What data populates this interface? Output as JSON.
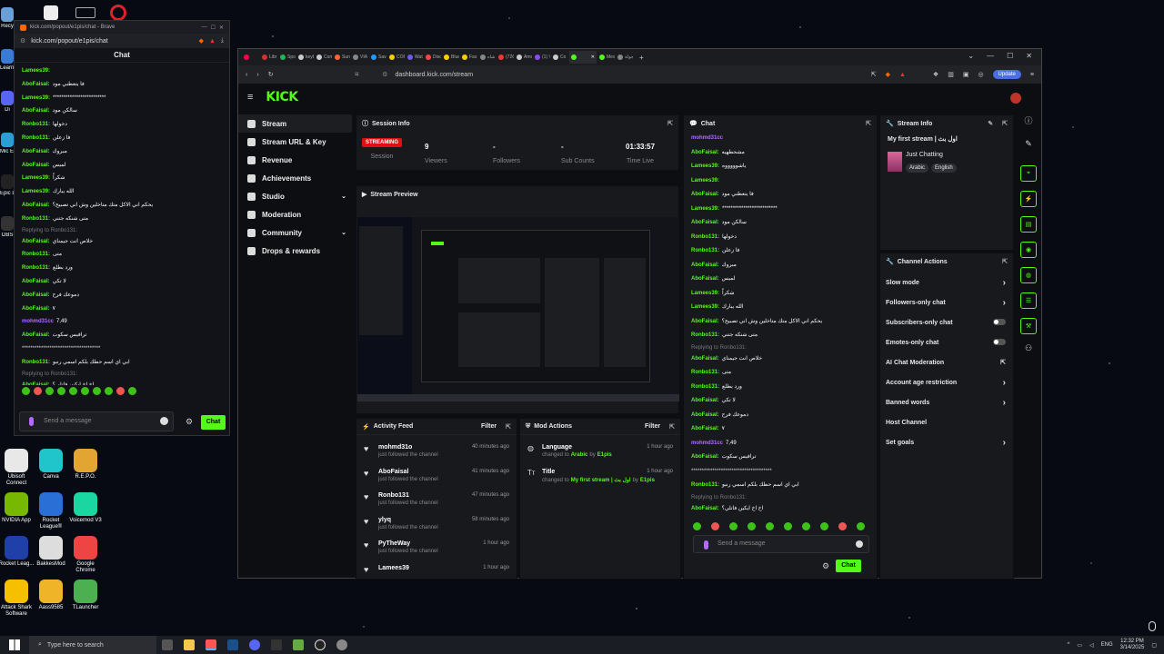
{
  "desktop": {
    "top_icons": [
      "Recy",
      "Learn this",
      "Di",
      "Mic Ed",
      "Epic Lau",
      "OBS"
    ],
    "bottom_icons": [
      {
        "label": "Ubisoft Connect",
        "color": "#e8e8e8"
      },
      {
        "label": "Canva",
        "color": "#20c4cb"
      },
      {
        "label": "R.E.P.O.",
        "color": "#e2a531"
      },
      {
        "label": "NVIDIA App",
        "color": "#76b900"
      },
      {
        "label": "Rocket League®",
        "color": "#2a6fd6"
      },
      {
        "label": "Voicemod V3",
        "color": "#1ad6a0"
      },
      {
        "label": "Rocket Leag...",
        "color": "#1e40a8"
      },
      {
        "label": "BakkesMod",
        "color": "#ddd"
      },
      {
        "label": "Google Chrome",
        "color": "#e44"
      },
      {
        "label": "Attack Shark Software",
        "color": "#f6c000"
      },
      {
        "label": "Aass9585",
        "color": "#f0b429"
      },
      {
        "label": "TLauncher",
        "color": "#4caf50"
      }
    ]
  },
  "popout": {
    "title": "kick.com/popout/e1pis/chat - Brave",
    "url": "kick.com/popout/e1pis/chat",
    "header": "Chat",
    "messages": [
      {
        "user": "Lamees39:",
        "text": "",
        "color": "g"
      },
      {
        "user": "AboFaisal:",
        "text": "فا يتعطني مود",
        "color": "g"
      },
      {
        "user": "Lamees39:",
        "text": "*************************",
        "color": "g"
      },
      {
        "user": "AboFaisal:",
        "text": "سالكن مود",
        "color": "g"
      },
      {
        "user": "Ronbo131:",
        "text": "دخولها",
        "color": "g"
      },
      {
        "user": "Ronbo131:",
        "text": "فا زعلن",
        "color": "g"
      },
      {
        "user": "AboFaisal:",
        "text": "مبروك",
        "color": "g"
      },
      {
        "user": "AboFaisal:",
        "text": "لميس",
        "color": "g"
      },
      {
        "user": "Lamees39:",
        "text": "شكراً",
        "color": "g"
      },
      {
        "user": "Lamees39:",
        "text": "الله يبارك",
        "color": "g"
      },
      {
        "user": "AboFaisal:",
        "text": "يحكم اني الاكل متك متاخلين وش اني تصبيح؟",
        "color": "g"
      },
      {
        "user": "Ronbo131:",
        "text": "متى شنكه جتني",
        "color": "g"
      },
      {
        "user": "AboFaisal:",
        "text": "خلاص انت جيمناي",
        "color": "g",
        "reply": "Replying to Ronbo131:"
      },
      {
        "user": "Ronbo131:",
        "text": "متى",
        "color": "g"
      },
      {
        "user": "Ronbo131:",
        "text": "ورد بطلع",
        "color": "g"
      },
      {
        "user": "AboFaisal:",
        "text": "لا تكي",
        "color": "g"
      },
      {
        "user": "AboFaisal:",
        "text": "دموعك فرح",
        "color": "g"
      },
      {
        "user": "AboFaisal:",
        "text": "٧",
        "color": "g"
      },
      {
        "user": "mohmd31cc",
        "text": "7,49",
        "color": "p"
      },
      {
        "user": "AboFaisal:",
        "text": "ترافيس سكوت",
        "color": "g"
      },
      {
        "user": "",
        "text": "*************************************",
        "color": "w"
      },
      {
        "user": "Ronbo131:",
        "text": "ابي اي اسم حطك بلكم اسمي رنبو",
        "color": "g"
      },
      {
        "user": "AboFaisal:",
        "text": "اخ اخ ايكين فاتلي؟",
        "color": "g",
        "reply": "Replying to Ronbo131:"
      }
    ],
    "input_placeholder": "Send a message",
    "chat_button": "Chat"
  },
  "browser": {
    "tabs": [
      {
        "label": "",
        "color": "#f04"
      },
      {
        "label": "Libr",
        "color": "#c33"
      },
      {
        "label": "Spo",
        "color": "#1db954"
      },
      {
        "label": "keyb",
        "color": "#ccc"
      },
      {
        "label": "Com",
        "color": "#ccc"
      },
      {
        "label": "Sun",
        "color": "#f63"
      },
      {
        "label": "VIA",
        "color": "#888"
      },
      {
        "label": "Save",
        "color": "#29f"
      },
      {
        "label": "COR",
        "color": "#fc0"
      },
      {
        "label": "Wat",
        "color": "#6c5ce7"
      },
      {
        "label": "Disc",
        "color": "#f44"
      },
      {
        "label": "Blue",
        "color": "#fc0"
      },
      {
        "label": "Fas",
        "color": "#fc0"
      },
      {
        "label": "شاه",
        "color": "#888"
      },
      {
        "label": "(726",
        "color": "#f33"
      },
      {
        "label": "Ams",
        "color": "#ccc"
      },
      {
        "label": "(1) V",
        "color": "#9146ff"
      },
      {
        "label": "Co",
        "color": "#ccc"
      },
      {
        "label": "",
        "color": "#53fc18",
        "active": true
      },
      {
        "label": "Mes",
        "color": "#53fc18"
      },
      {
        "label": "جولة",
        "color": "#888"
      }
    ],
    "url": "dashboard.kick.com/stream",
    "update_button": "Update"
  },
  "kick": {
    "logo": "KICK",
    "nav": [
      {
        "label": "Stream",
        "active": true
      },
      {
        "label": "Stream URL & Key"
      },
      {
        "label": "Revenue"
      },
      {
        "label": "Achievements"
      },
      {
        "label": "Studio",
        "chevron": true
      },
      {
        "label": "Moderation"
      },
      {
        "label": "Community",
        "chevron": true
      },
      {
        "label": "Drops & rewards"
      }
    ],
    "session": {
      "title": "Session Info",
      "status": "STREAMING",
      "session_label": "Session",
      "viewers_value": "9",
      "viewers_label": "Viewers",
      "followers_value": "-",
      "followers_label": "Followers",
      "subs_value": "-",
      "subs_label": "Sub Counts",
      "time_value": "01:33:57",
      "time_label": "Time Live"
    },
    "preview_title": "Stream Preview",
    "activity": {
      "title": "Activity Feed",
      "filter": "Filter",
      "items": [
        {
          "name": "mohmd31o",
          "sub": "just followed the channel",
          "time": "40 minutes ago"
        },
        {
          "name": "AboFaisal",
          "sub": "just followed the channel",
          "time": "41 minutes ago"
        },
        {
          "name": "Ronbo131",
          "sub": "just followed the channel",
          "time": "47 minutes ago"
        },
        {
          "name": "ylyq",
          "sub": "just followed the channel",
          "time": "58 minutes ago"
        },
        {
          "name": "PyTheWay",
          "sub": "just followed the channel",
          "time": "1 hour ago"
        },
        {
          "name": "Lamees39",
          "sub": "",
          "time": "1 hour ago"
        }
      ]
    },
    "mod": {
      "title": "Mod Actions",
      "filter": "Filter",
      "items": [
        {
          "name": "Language",
          "sub_prefix": "changed to",
          "sub_value": "Arabic",
          "by": "by",
          "user": "E1pis",
          "time": "1 hour ago"
        },
        {
          "name": "Title",
          "sub_prefix": "changed to",
          "sub_value": "My first stream | اول بث",
          "by": "by",
          "user": "E1pis",
          "time": "1 hour ago"
        }
      ]
    },
    "chat": {
      "title": "Chat",
      "messages": [
        {
          "user": "mohmd31cc",
          "text": "",
          "color": "p"
        },
        {
          "user": "AboFaisal:",
          "text": "مشحطهيه",
          "color": "g"
        },
        {
          "user": "Lamees39:",
          "text": "ياشوووووه",
          "color": "g"
        },
        {
          "user": "Lamees39:",
          "text": "",
          "color": "g"
        },
        {
          "user": "AboFaisal:",
          "text": "فا يتعطني مود",
          "color": "g"
        },
        {
          "user": "Lamees39:",
          "text": "**************************",
          "color": "g"
        },
        {
          "user": "AboFaisal:",
          "text": "سالكن مود",
          "color": "g"
        },
        {
          "user": "Ronbo131:",
          "text": "دخولها",
          "color": "g"
        },
        {
          "user": "Ronbo131:",
          "text": "فا زعلن",
          "color": "g"
        },
        {
          "user": "AboFaisal:",
          "text": "مبروك",
          "color": "g"
        },
        {
          "user": "AboFaisal:",
          "text": "لميس",
          "color": "g"
        },
        {
          "user": "Lamees39:",
          "text": "شكراً",
          "color": "g"
        },
        {
          "user": "Lamees39:",
          "text": "الله يبارك",
          "color": "g"
        },
        {
          "user": "AboFaisal:",
          "text": "يحكم اني الاكل متك متاخلين وش اني تصبيح؟",
          "color": "g"
        },
        {
          "user": "Ronbo131:",
          "text": "متى شنكه جتني",
          "color": "g"
        },
        {
          "user": "AboFaisal:",
          "text": "خلاص انت جيمناي",
          "color": "g",
          "reply": "Replying to Ronbo131:"
        },
        {
          "user": "Ronbo131:",
          "text": "متى",
          "color": "g"
        },
        {
          "user": "Ronbo131:",
          "text": "ورد بطلع",
          "color": "g"
        },
        {
          "user": "AboFaisal:",
          "text": "لا تكي",
          "color": "g"
        },
        {
          "user": "AboFaisal:",
          "text": "دموعك فرح",
          "color": "g"
        },
        {
          "user": "AboFaisal:",
          "text": "٧",
          "color": "g"
        },
        {
          "user": "mohmd31cc",
          "text": "7,49",
          "color": "p"
        },
        {
          "user": "AboFaisal:",
          "text": "ترافيس سكوت",
          "color": "g"
        },
        {
          "user": "",
          "text": "**************************************",
          "color": "w"
        },
        {
          "user": "Ronbo131:",
          "text": "ابي اي اسم حطك بلكم اسمي رنبو",
          "color": "g"
        },
        {
          "user": "AboFaisal:",
          "text": "اخ اخ ايكين فاتلي؟",
          "color": "g",
          "reply": "Replying to Ronbo131:"
        }
      ],
      "placeholder": "Send a message",
      "button": "Chat"
    },
    "stream_info": {
      "title": "Stream Info",
      "stream_title": "My first stream | اول بث",
      "category": "Just Chatting",
      "tags": [
        "Arabic",
        "English"
      ]
    },
    "channel_actions": {
      "title": "Channel Actions",
      "rows": [
        {
          "label": "Slow mode",
          "kind": "chevron"
        },
        {
          "label": "Followers-only chat",
          "kind": "chevron"
        },
        {
          "label": "Subscribers-only chat",
          "kind": "toggle"
        },
        {
          "label": "Emotes-only chat",
          "kind": "toggle"
        },
        {
          "label": "AI Chat Moderation",
          "kind": "external"
        },
        {
          "label": "Account age restriction",
          "kind": "chevron"
        },
        {
          "label": "Banned words",
          "kind": "chevron"
        },
        {
          "label": "Host Channel",
          "kind": "none"
        },
        {
          "label": "Set goals",
          "kind": "chevron"
        }
      ]
    }
  },
  "taskbar": {
    "search_placeholder": "Type here to search",
    "lang": "ENG",
    "time": "12:32 PM",
    "date": "3/14/2025"
  },
  "colors": {
    "kick_green": "#53fc18",
    "live_red": "#e01010",
    "purple": "#b36bff"
  }
}
